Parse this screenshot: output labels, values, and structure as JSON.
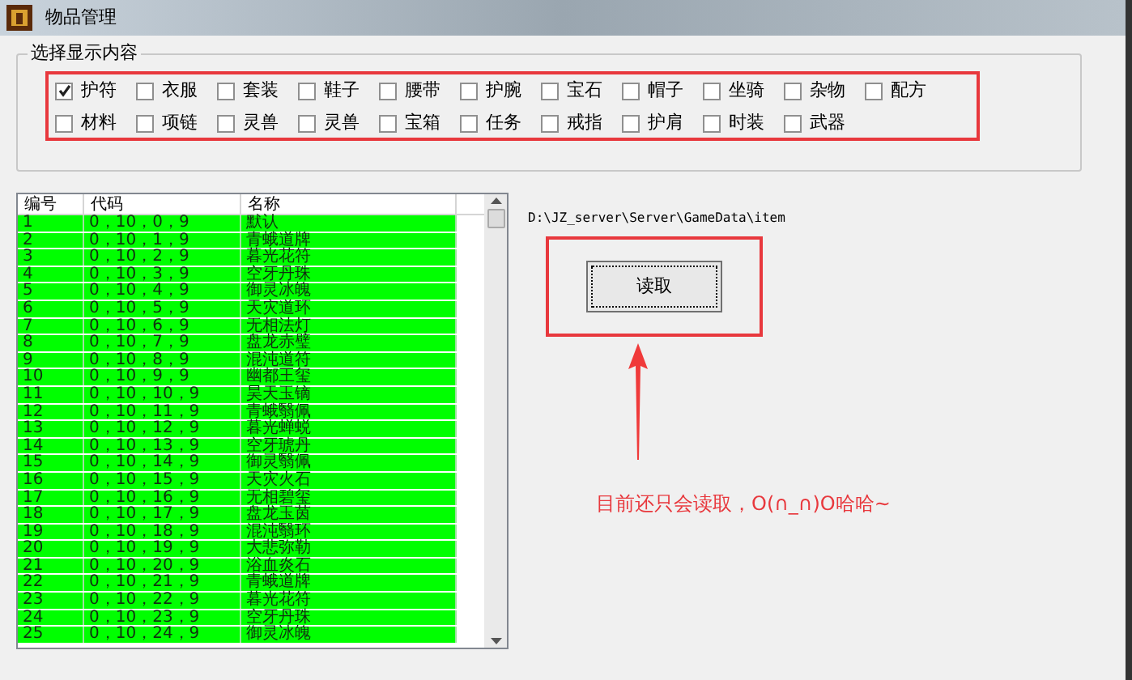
{
  "window": {
    "title": "物品管理"
  },
  "filter_group": {
    "title": "选择显示内容",
    "options": [
      {
        "label": "护符",
        "checked": true
      },
      {
        "label": "衣服",
        "checked": false
      },
      {
        "label": "套装",
        "checked": false
      },
      {
        "label": "鞋子",
        "checked": false
      },
      {
        "label": "腰带",
        "checked": false
      },
      {
        "label": "护腕",
        "checked": false
      },
      {
        "label": "宝石",
        "checked": false
      },
      {
        "label": "帽子",
        "checked": false
      },
      {
        "label": "坐骑",
        "checked": false
      },
      {
        "label": "杂物",
        "checked": false
      },
      {
        "label": "配方",
        "checked": false
      },
      {
        "label": "材料",
        "checked": false
      },
      {
        "label": "项链",
        "checked": false
      },
      {
        "label": "灵兽",
        "checked": false
      },
      {
        "label": "灵兽",
        "checked": false
      },
      {
        "label": "宝箱",
        "checked": false
      },
      {
        "label": "任务",
        "checked": false
      },
      {
        "label": "戒指",
        "checked": false
      },
      {
        "label": "护肩",
        "checked": false
      },
      {
        "label": "时装",
        "checked": false
      },
      {
        "label": "武器",
        "checked": false
      }
    ]
  },
  "table": {
    "columns": [
      "编号",
      "代码",
      "名称"
    ],
    "rows": [
      [
        "1",
        "0，10，0，9",
        "默认"
      ],
      [
        "2",
        "0，10，1，9",
        "青蛾道牌"
      ],
      [
        "3",
        "0，10，2，9",
        "暮光花符"
      ],
      [
        "4",
        "0，10，3，9",
        "空牙丹珠"
      ],
      [
        "5",
        "0，10，4，9",
        "御灵冰魄"
      ],
      [
        "6",
        "0，10，5，9",
        "天灾道环"
      ],
      [
        "7",
        "0，10，6，9",
        "无相法灯"
      ],
      [
        "8",
        "0，10，7，9",
        "盘龙赤璧"
      ],
      [
        "9",
        "0，10，8，9",
        "混沌道符"
      ],
      [
        "10",
        "0，10，9，9",
        "幽都王玺"
      ],
      [
        "11",
        "0，10，10，9",
        "昊天玉镝"
      ],
      [
        "12",
        "0，10，11，9",
        "青蛾翳佩"
      ],
      [
        "13",
        "0，10，12，9",
        "暮光蝉蜕"
      ],
      [
        "14",
        "0，10，13，9",
        "空牙琥丹"
      ],
      [
        "15",
        "0，10，14，9",
        "御灵翳佩"
      ],
      [
        "16",
        "0，10，15，9",
        "天灾火石"
      ],
      [
        "17",
        "0，10，16，9",
        "无相碧玺"
      ],
      [
        "18",
        "0，10，17，9",
        "盘龙玉茵"
      ],
      [
        "19",
        "0，10，18，9",
        "混沌翳环"
      ],
      [
        "20",
        "0，10，19，9",
        "大悲弥勒"
      ],
      [
        "21",
        "0，10，20，9",
        "浴血炎石"
      ],
      [
        "22",
        "0，10，21，9",
        "青蛾道牌"
      ],
      [
        "23",
        "0，10，22，9",
        "暮光花符"
      ],
      [
        "24",
        "0，10，23，9",
        "空牙丹珠"
      ],
      [
        "25",
        "0，10，24，9",
        "御灵冰魄"
      ]
    ]
  },
  "path": "D:\\JZ_server\\Server\\GameData\\item",
  "read_button": "读取",
  "annotation": "目前还只会读取，O(∩_∩)O哈哈~"
}
